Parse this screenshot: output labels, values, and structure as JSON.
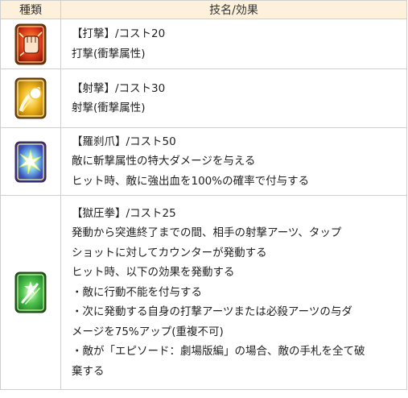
{
  "header": {
    "col_type": "種類",
    "col_effect": "技名/効果"
  },
  "skills": [
    {
      "icon": "fist-card-icon",
      "lines": [
        "【打撃】/コスト20",
        "打撃(衝撃属性)"
      ]
    },
    {
      "icon": "comet-card-icon",
      "lines": [
        "【射撃】/コスト30",
        "射撃(衝撃属性)"
      ]
    },
    {
      "icon": "claw-burst-card-icon",
      "lines": [
        "【羅刹爪】/コスト50",
        "敵に斬撃属性の特大ダメージを与える",
        "ヒット時、敵に強出血を100%の確率で付与する"
      ]
    },
    {
      "icon": "green-slash-card-icon",
      "lines": [
        "【獄圧拳】/コスト25",
        "発動から突進終了までの間、相手の射撃アーツ、タップ",
        "ショットに対してカウンターが発動する",
        "ヒット時、以下の効果を発動する",
        "・敵に行動不能を付与する",
        "・次に発動する自身の打撃アーツまたは必殺アーツの与ダ",
        "メージを75%アップ(重複不可)",
        "・敵が「エピソード：劇場版編」の場合、敵の手札を全て破",
        "棄する"
      ]
    }
  ]
}
